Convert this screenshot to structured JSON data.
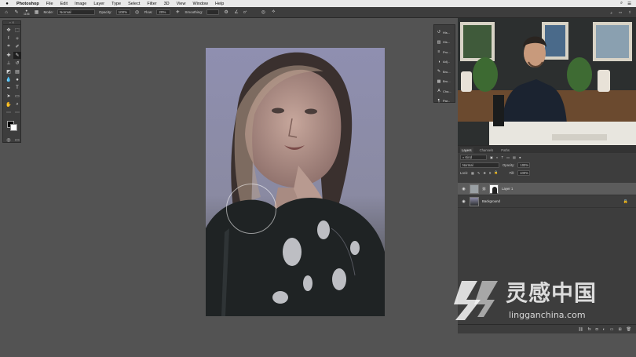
{
  "menubar": {
    "apple": "",
    "app": "Photoshop",
    "items": [
      "File",
      "Edit",
      "Image",
      "Layer",
      "Type",
      "Select",
      "Filter",
      "3D",
      "View",
      "Window",
      "Help"
    ]
  },
  "options": {
    "brush_size": "1156",
    "mode_label": "Mode:",
    "mode_value": "Normal",
    "opacity_label": "Opacity:",
    "opacity_value": "100%",
    "flow_label": "Flow:",
    "flow_value": "20%",
    "smoothing_label": "Smoothing:",
    "angle_value": "0°"
  },
  "mini_panel": [
    "His...",
    "His...",
    "Pro...",
    "Adj...",
    "Bru...",
    "Bru...",
    "Cha...",
    "Par..."
  ],
  "layers_panel": {
    "tabs": [
      "Layers",
      "Channels",
      "Paths"
    ],
    "kind_filter": "Kind",
    "blend_mode": "Normal",
    "opacity_label": "Opacity:",
    "opacity_value": "100%",
    "lock_label": "Lock:",
    "fill_label": "Fill:",
    "fill_value": "100%",
    "layers": [
      {
        "name": "Layer 1",
        "selected": true
      },
      {
        "name": "Background",
        "selected": false
      }
    ]
  },
  "watermark": {
    "cn": "灵感中国",
    "url": "lingganchina.com"
  },
  "colors": {
    "canvas_bg": "#535353",
    "panel_bg": "#3d3d3d",
    "menubar": "#e9e9e9",
    "selected_layer": "#5c5c5c"
  }
}
